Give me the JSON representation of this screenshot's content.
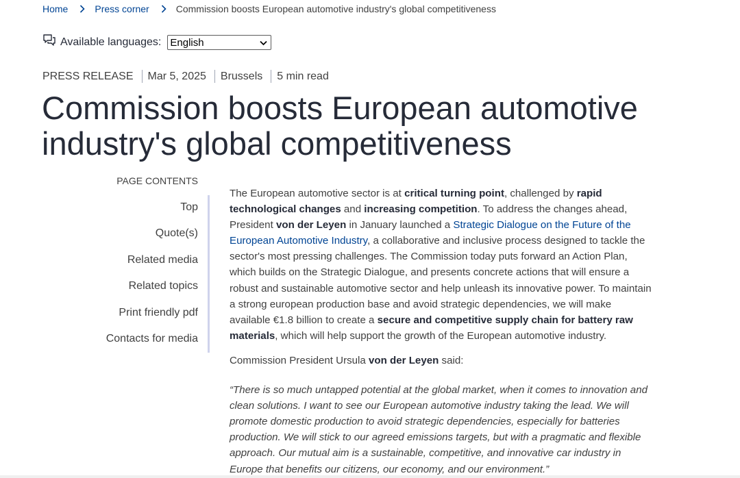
{
  "breadcrumb": {
    "home": "Home",
    "press_corner": "Press corner",
    "current": "Commission boosts European automotive industry's global competitiveness"
  },
  "languages": {
    "label": "Available languages:",
    "selected": "English"
  },
  "meta": {
    "type": "PRESS RELEASE",
    "date": "Mar 5, 2025",
    "location": "Brussels",
    "read_time": "5 min read"
  },
  "title_line1": "Commission boosts European automotive",
  "title_line2": "industry's global competitiveness",
  "toc": {
    "heading": "PAGE CONTENTS",
    "items": [
      "Top",
      "Quote(s)",
      "Related media",
      "Related topics",
      "Print friendly pdf",
      "Contacts for media"
    ]
  },
  "body": {
    "p1": [
      "The European automotive sector is at ",
      "critical turning point",
      ", challenged by ",
      "rapid technological changes",
      " and ",
      "increasing competition",
      ". To address the changes ahead, President ",
      "von der Leyen",
      " in January launched a ",
      "Strategic Dialogue on the Future of the European Automotive Industry",
      ", a collaborative and inclusive process designed to tackle the sector's most pressing challenges. The Commission today puts forward an Action Plan, which builds on the Strategic Dialogue, and presents concrete actions that will ensure a robust and sustainable automotive sector and help unleash its innovative power. To maintain a strong european production base and avoid strategic dependencies, we will make available €1.8 billion to create a ",
      "secure and competitive supply chain for battery raw materials",
      ", which will help support the growth of the European automotive industry."
    ],
    "p2": [
      "Commission President Ursula ",
      "von der Leyen",
      " said:"
    ],
    "quote": "“There is so much untapped potential at the global market, when it comes to innovation and clean solutions. I want to see our European automotive industry taking the lead. We will promote domestic production to avoid strategic dependencies, especially for batteries production.  We will stick to our agreed emissions targets, but with a pragmatic and flexible approach. Our mutual aim is a sustainable, competitive, and innovative car industry in Europe that benefits our citizens, our economy, and our environment.”"
  },
  "colors": {
    "link": "#004494",
    "heading": "#262b38",
    "text": "#404040",
    "toc_rule": "#cfd3ec"
  }
}
